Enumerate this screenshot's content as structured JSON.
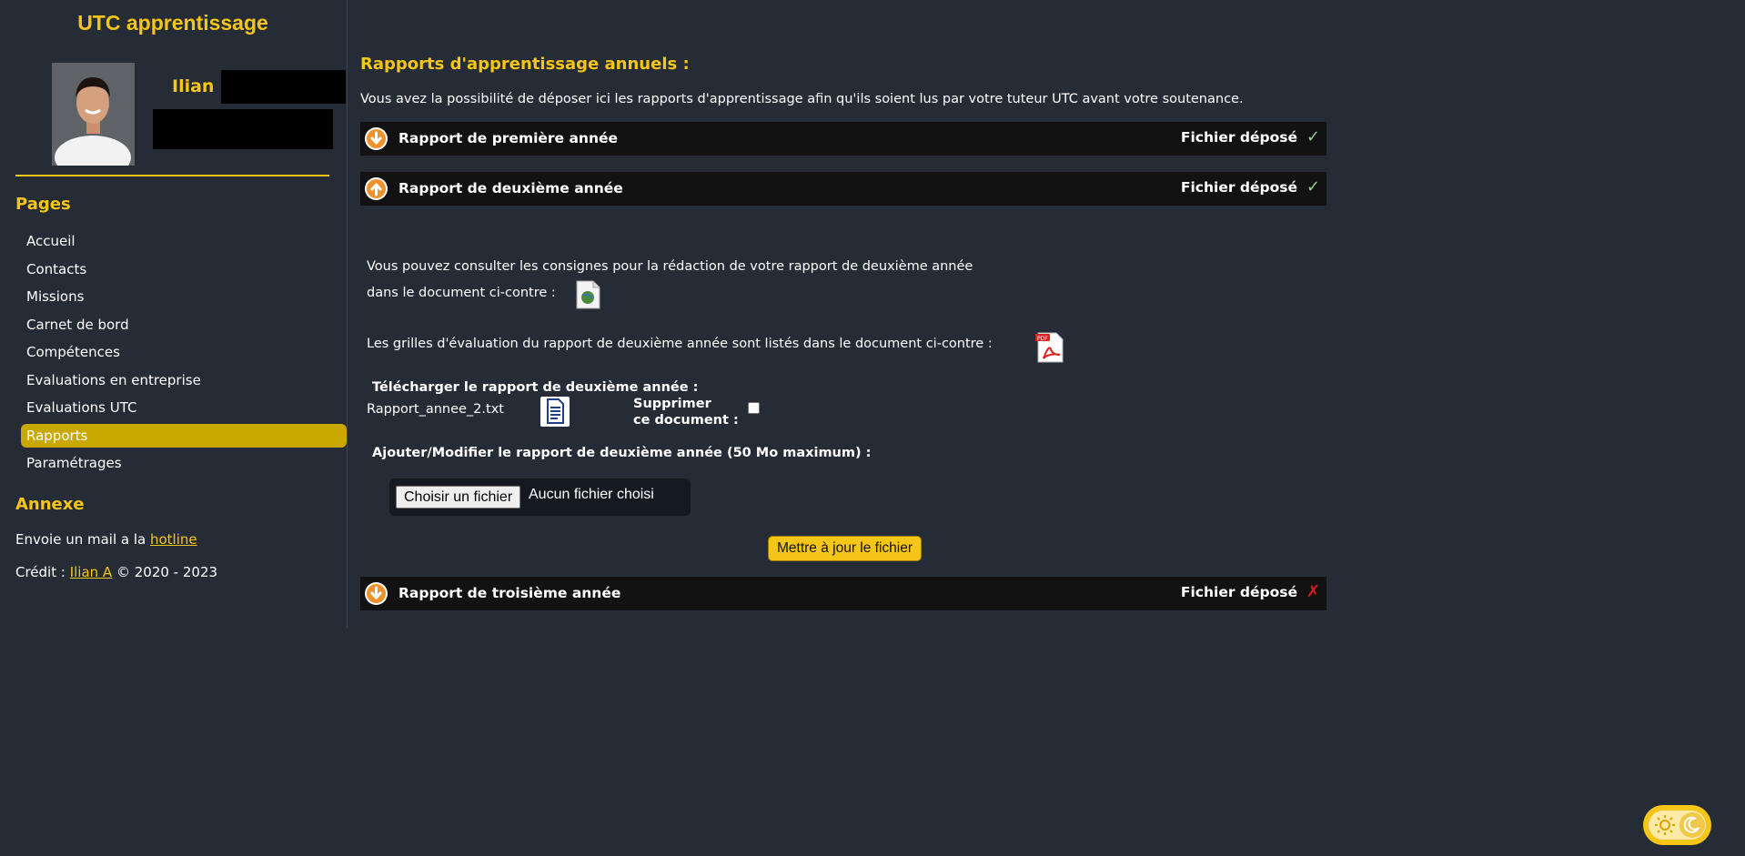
{
  "sidebar": {
    "site_title": "UTC apprentissage",
    "user_first_name": "Ilian",
    "pages_heading": "Pages",
    "nav": [
      "Accueil",
      "Contacts",
      "Missions",
      "Carnet de bord",
      "Compétences",
      "Evaluations en entreprise",
      "Evaluations UTC",
      "Rapports",
      "Paramétrages"
    ],
    "active_item": "Rapports",
    "annexe_heading": "Annexe",
    "mail_text": "Envoie un mail a la ",
    "mail_link": "hotline",
    "credit_prefix": "Crédit : ",
    "credit_link": "Ilian A",
    "credit_suffix": " © 2020 - 2023"
  },
  "main": {
    "title": "Rapports d'apprentissage annuels :",
    "intro": "Vous avez la possibilité de déposer ici les rapports d'apprentissage afin qu'ils soient lus par votre tuteur UTC avant votre soutenance.",
    "reports": [
      {
        "title": "Rapport de première année",
        "status": "Fichier déposé",
        "mark": "✓",
        "deposited": true,
        "expanded": false
      },
      {
        "title": "Rapport de deuxième année",
        "status": "Fichier déposé",
        "mark": "✓",
        "deposited": true,
        "expanded": true
      },
      {
        "title": "Rapport de troisième année",
        "status": "Fichier déposé",
        "mark": "✗",
        "deposited": false,
        "expanded": false
      }
    ],
    "second_year": {
      "consignes_line1": "Vous pouvez consulter les consignes pour la rédaction de votre rapport de deuxième année",
      "consignes_line2": "dans le document ci-contre :",
      "grilles_text": "Les grilles d'évaluation du rapport de deuxième année sont listés dans le document ci-contre :",
      "download_label": "Télécharger le rapport de deuxième année :",
      "file_name": "Rapport_annee_2.txt",
      "delete_label_line1": "Supprimer",
      "delete_label_line2": "ce document :",
      "delete_checked": false,
      "upload_label": "Ajouter/Modifier le rapport de deuxième année (50 Mo maximum) :",
      "choose_button": "Choisir un fichier",
      "no_file": "Aucun fichier choisi",
      "update_button": "Mettre à jour le fichier"
    }
  },
  "theme_toggle": {
    "mode": "light",
    "icons": [
      "sun-icon",
      "moon-icon"
    ]
  },
  "colors": {
    "accent": "#f5c518",
    "background": "#252c35",
    "bar": "#121212",
    "active_nav": "#c9a800",
    "icon_orange": "#f0922b",
    "ok": "#8fd18f",
    "error": "#d81b1b"
  }
}
